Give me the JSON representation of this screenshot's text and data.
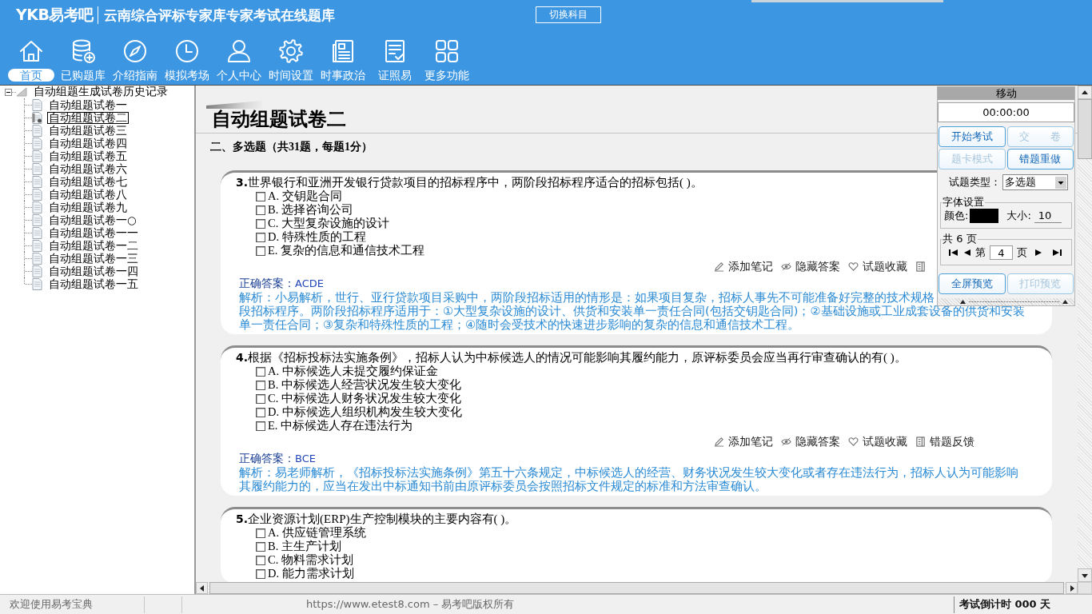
{
  "header": {
    "logo": "YKB易考吧",
    "title": "云南综合评标专家库专家考试在线题库",
    "switch_button": "切换科目"
  },
  "nav": [
    {
      "kind": "home",
      "label": "首页",
      "selected": true
    },
    {
      "kind": "database",
      "label": "已购题库",
      "selected": false
    },
    {
      "kind": "compass",
      "label": "介绍指南",
      "selected": false
    },
    {
      "kind": "clock",
      "label": "模拟考场",
      "selected": false
    },
    {
      "kind": "person",
      "label": "个人中心",
      "selected": false
    },
    {
      "kind": "gear",
      "label": "时间设置",
      "selected": false
    },
    {
      "kind": "news",
      "label": "时事政治",
      "selected": false
    },
    {
      "kind": "checklist",
      "label": "证照易",
      "selected": false
    },
    {
      "kind": "grid",
      "label": "更多功能",
      "selected": false
    }
  ],
  "tree": {
    "label": "自动组题生成试卷历史记录",
    "expanded": true,
    "children": [
      {
        "label": "自动组题试卷一",
        "selected": false
      },
      {
        "label": "自动组题试卷二",
        "selected": true
      },
      {
        "label": "自动组题试卷三",
        "selected": false
      },
      {
        "label": "自动组题试卷四",
        "selected": false
      },
      {
        "label": "自动组题试卷五",
        "selected": false
      },
      {
        "label": "自动组题试卷六",
        "selected": false
      },
      {
        "label": "自动组题试卷七",
        "selected": false
      },
      {
        "label": "自动组题试卷八",
        "selected": false
      },
      {
        "label": "自动组题试卷九",
        "selected": false
      },
      {
        "label": "自动组题试卷一○",
        "selected": false
      },
      {
        "label": "自动组题试卷一一",
        "selected": false
      },
      {
        "label": "自动组题试卷一二",
        "selected": false
      },
      {
        "label": "自动组题试卷一三",
        "selected": false
      },
      {
        "label": "自动组题试卷一四",
        "selected": false
      },
      {
        "label": "自动组题试卷一五",
        "selected": false
      }
    ]
  },
  "paper": {
    "title": "自动组题试卷二",
    "section": "二、多选题（共31题，每题1分）",
    "questions": [
      {
        "number": "3.",
        "text": "世界银行和亚洲开发银行贷款项目的招标程序中，两阶段招标程序适合的招标包括( )。",
        "options": [
          {
            "label": "A. 交钥匙合同",
            "checked": false
          },
          {
            "label": "B. 选择咨询公司",
            "checked": false
          },
          {
            "label": "C. 大型复杂设施的设计",
            "checked": false
          },
          {
            "label": "D. 特殊性质的工程",
            "checked": false
          },
          {
            "label": "E. 复杂的信息和通信技术工程",
            "checked": false
          }
        ],
        "actions": [
          {
            "kind": "note",
            "label": "添加笔记"
          },
          {
            "kind": "hide",
            "label": "隐藏答案"
          },
          {
            "kind": "favorite",
            "label": "试题收藏"
          },
          {
            "kind": "feedback"
          }
        ],
        "answer_label": "正确答案：",
        "answer": "ACDE",
        "explanation_lines": [
          "解析：小易解析，世行、亚行贷款项目采购中，两阶段招标适用的情形是：如果项目复杂，招标人事先不可能准备好完整的技术规格",
          "段招标程序。两阶段招标程序适用于：①大型复杂设施的设计、供货和安装单一责任合同(包括交钥匙合同)；②基础设施或工业成套设备的供货和安装",
          "单一责任合同；③复杂和特殊性质的工程；④随时会受技术的快速进步影响的复杂的信息和通信技术工程。"
        ]
      },
      {
        "number": "4.",
        "text": "根据《招标投标法实施条例》，招标人认为中标候选人的情况可能影响其履约能力，原评标委员会应当再行审查确认的有( )。",
        "options": [
          {
            "label": "A. 中标候选人未提交履约保证金",
            "checked": false
          },
          {
            "label": "B. 中标候选人经营状况发生较大变化",
            "checked": false
          },
          {
            "label": "C. 中标候选人财务状况发生较大变化",
            "checked": false
          },
          {
            "label": "D. 中标候选人组织机构发生较大变化",
            "checked": false
          },
          {
            "label": "E. 中标候选人存在违法行为",
            "checked": false
          }
        ],
        "actions": [
          {
            "kind": "note",
            "label": "添加笔记"
          },
          {
            "kind": "hide",
            "label": "隐藏答案"
          },
          {
            "kind": "favorite",
            "label": "试题收藏"
          },
          {
            "kind": "feedback",
            "label": "错题反馈"
          }
        ],
        "answer_label": "正确答案：",
        "answer": "BCE",
        "explanation_lines": [
          "解析：易老师解析，《招标投标法实施条例》第五十六条规定，中标候选人的经营、财务状况发生较大变化或者存在违法行为，招标人认为可能影响",
          "其履约能力的，应当在发出中标通知书前由原评标委员会按照招标文件规定的标准和方法审查确认。"
        ]
      },
      {
        "number": "5.",
        "text": "企业资源计划(ERP)生产控制模块的主要内容有( )。",
        "options": [
          {
            "label": "A. 供应链管理系统",
            "checked": false
          },
          {
            "label": "B. 主生产计划",
            "checked": false
          },
          {
            "label": "C. 物料需求计划",
            "checked": false
          },
          {
            "label": "D. 能力需求计划",
            "checked": false
          }
        ]
      }
    ]
  },
  "panel": {
    "title": "移动",
    "timer": "00:00:00",
    "buttons": [
      {
        "label": "开始考试",
        "disabled": false
      },
      {
        "label": "交　　卷",
        "disabled": true
      },
      {
        "label": "题卡模式",
        "disabled": true
      },
      {
        "label": "错题重做",
        "disabled": false
      }
    ],
    "type_label": "试题类型：",
    "type_value": "多选题",
    "font_title": "字体设置",
    "color_label": "颜色:",
    "color": "#000000",
    "size_label": "大小:",
    "size_value": "10",
    "pages_title": "共 6 页",
    "page_prefix": "第",
    "page_value": "4",
    "page_suffix": "页",
    "bottom_buttons": [
      {
        "label": "全屏预览",
        "disabled": false
      },
      {
        "label": "打印预览",
        "disabled": true
      }
    ]
  },
  "status_bar": {
    "welcome": "欢迎使用易考宝典",
    "copyright": "https://www.etest8.com – 易考吧版权所有",
    "countdown": "考试倒计时 000 天"
  }
}
